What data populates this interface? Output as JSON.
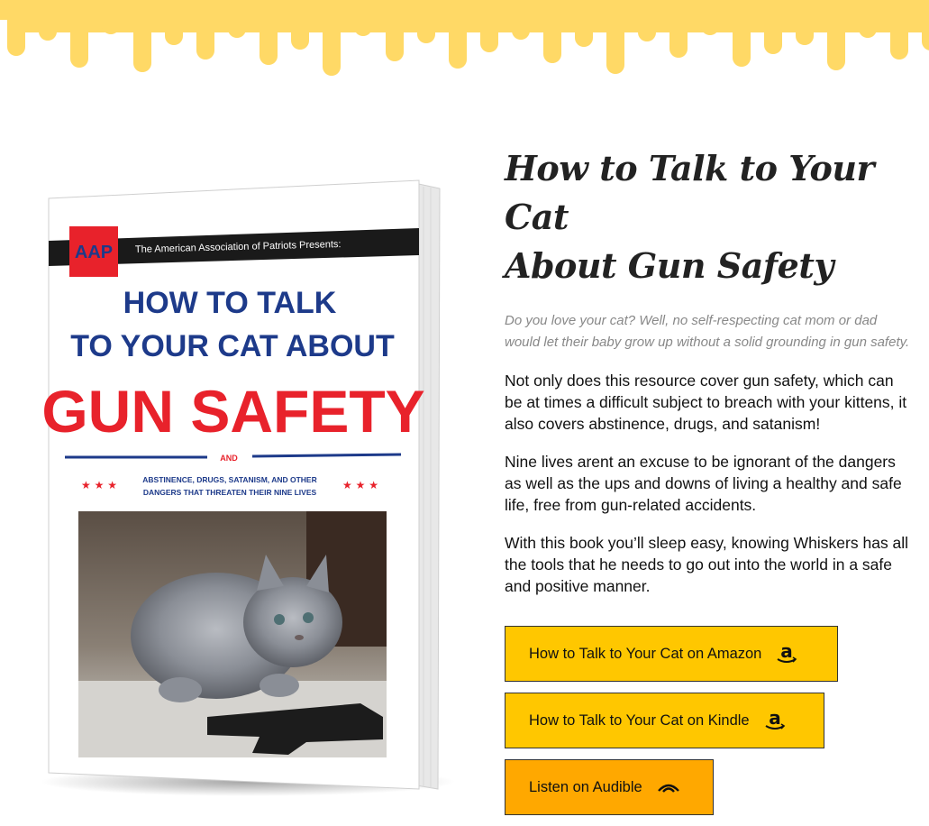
{
  "header": {
    "drip_color": "#ffd966"
  },
  "book": {
    "badge": "AAP",
    "presents": "The American Association of Patriots Presents:",
    "title_line1": "HOW TO TALK",
    "title_line2": "TO YOUR CAT ABOUT",
    "title_line3": "GUN SAFETY",
    "and": "AND",
    "subtitle_line1": "ABSTINENCE, DRUGS, SATANISM, AND OTHER",
    "subtitle_line2": "DANGERS THAT THREATEN THEIR NINE LIVES",
    "stars": "★ ★ ★"
  },
  "main": {
    "title_line1": "How to Talk to Your Cat",
    "title_line2": "About Gun Safety",
    "intro": "Do you love your cat? Well, no self-respecting cat mom or dad would let their baby grow up without a solid grounding in gun safety.",
    "paragraphs": [
      "Not only does this resource cover gun safety, which can be at times a difficult subject to breach with your kittens, it also covers abstinence, drugs, and satanism!",
      "Nine lives arent an excuse to be ignorant of the dangers as well as the ups and downs of living a healthy and safe life, free from gun-related accidents.",
      "With this book you’ll sleep easy, knowing Whiskers has all the tools that he needs to go out into the world in a safe and positive manner."
    ]
  },
  "buttons": {
    "amazon": "How to Talk to Your Cat on Amazon",
    "kindle": "How to Talk to Your Cat on Kindle",
    "audible": "Listen on Audible",
    "amazon_icon": "amazon-icon",
    "audible_icon": "audible-icon",
    "colors": {
      "amazon": "#ffc700",
      "audible": "#ffa800"
    }
  }
}
